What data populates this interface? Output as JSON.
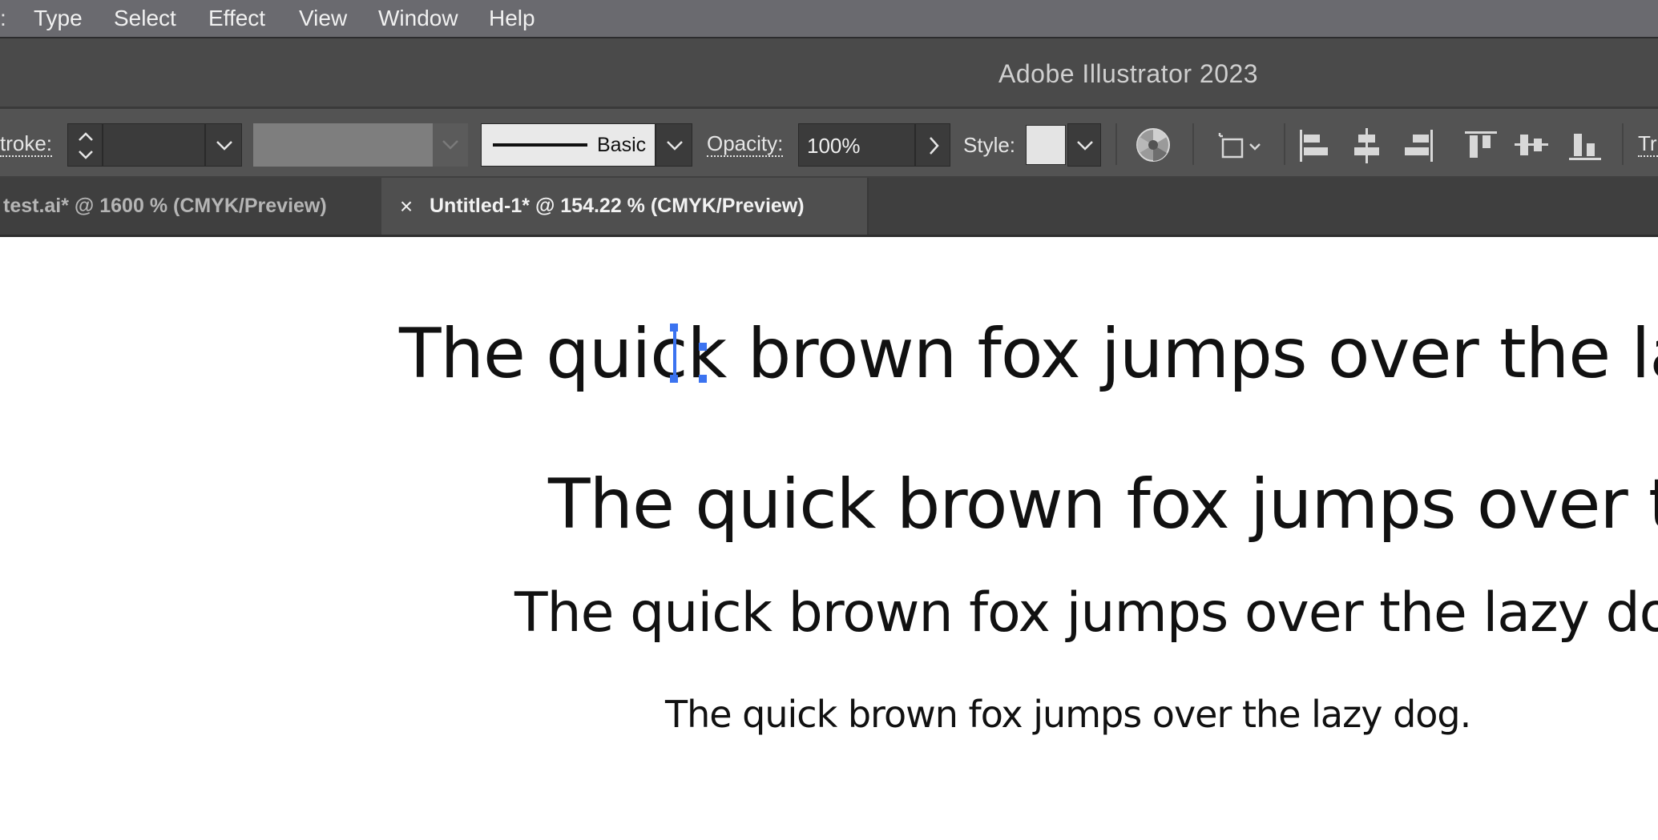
{
  "menubar": {
    "items": [
      "Type",
      "Select",
      "Effect",
      "View",
      "Window",
      "Help"
    ]
  },
  "titlebar": {
    "title": "Adobe Illustrator 2023"
  },
  "controlbar": {
    "stroke_label": "troke:",
    "brush_label": "Basic",
    "opacity_label": "Opacity:",
    "opacity_value": "100%",
    "style_label": "Style:",
    "transform_label": "Tr"
  },
  "tabs": [
    {
      "label": "test.ai* @ 1600 % (CMYK/Preview)",
      "active": false
    },
    {
      "label": "Untitled-1* @ 154.22 % (CMYK/Preview)",
      "active": true
    }
  ],
  "canvas": {
    "line1": "The quick brown fox jumps over the lazy",
    "line2": "The quick brown fox jumps over the",
    "line3": "The quick brown fox jumps over the lazy dog.",
    "line4": "The quick brown fox jumps over the lazy dog."
  },
  "colors": {
    "selection": "#3b73f0",
    "menubar": "#6a6a6f",
    "controlbar": "#535353"
  }
}
